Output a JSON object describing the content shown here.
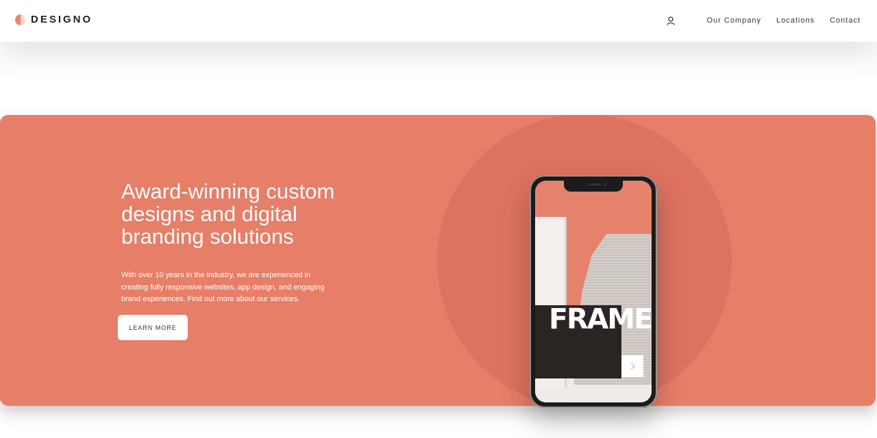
{
  "brand": {
    "name": "DESIGNO",
    "accent": "#e77e68"
  },
  "top_indicator": {
    "progress": 0.2
  },
  "nav": {
    "user_icon": "user-icon",
    "links": [
      "Our Company",
      "Locations",
      "Contact"
    ]
  },
  "hero": {
    "title": "Award-winning custom designs and digital branding solutions",
    "text": "With over 10 years in the industry, we are experienced in creating fully responsive websites, app design, and engaging brand experiences. Find out more about our services.",
    "cta": "LEARN MORE",
    "phone_screen": {
      "headline": "FRAME",
      "next_icon": "chevron-right-icon"
    }
  }
}
